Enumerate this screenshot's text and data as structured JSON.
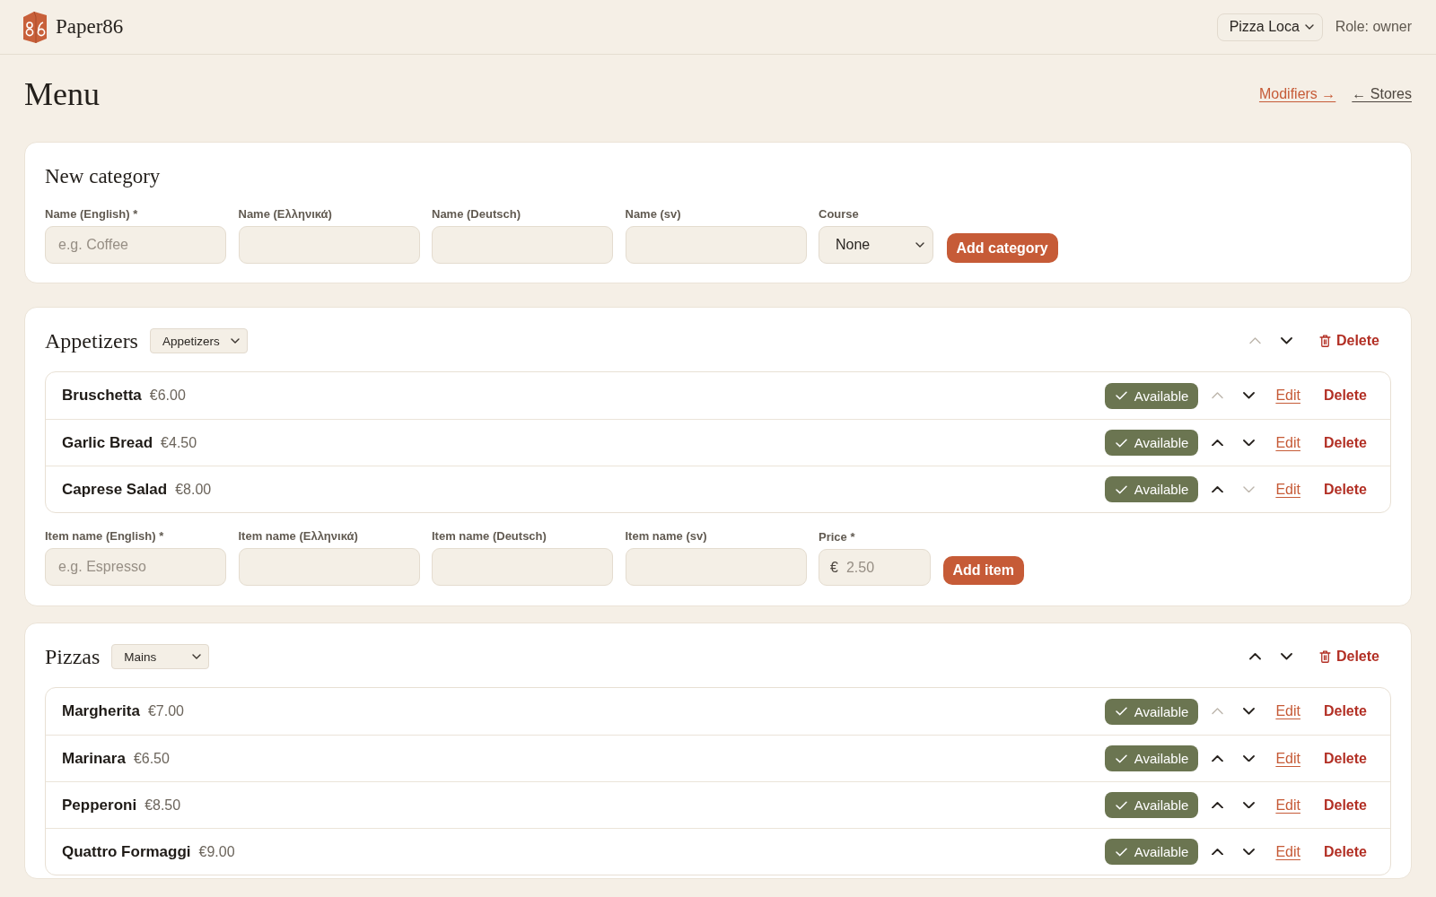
{
  "header": {
    "brand": "Paper86",
    "store": "Pizza Loca",
    "role": "Role: owner"
  },
  "page": {
    "title": "Menu",
    "links": [
      {
        "label": "Modifiers →",
        "kind": "forward"
      },
      {
        "label": "← Stores",
        "kind": "back"
      }
    ]
  },
  "new_category": {
    "title": "New category",
    "fields": [
      {
        "label": "Name (English) *",
        "placeholder": "e.g. Coffee"
      },
      {
        "label": "Name (Ελληνικά)"
      },
      {
        "label": "Name (Deutsch)"
      },
      {
        "label": "Name (sv)"
      }
    ],
    "course": {
      "label": "Course",
      "value": "None"
    },
    "button": "Add category"
  },
  "categories": [
    {
      "name": "Appetizers",
      "course": "Appetizers",
      "up_disabled": true,
      "down_disabled": false,
      "delete": "Delete",
      "items": [
        {
          "name": "Bruschetta",
          "price": "€6.00",
          "available": true,
          "status": "Available",
          "up_disabled": true,
          "down_disabled": false,
          "edit": "Edit",
          "delete": "Delete"
        },
        {
          "name": "Garlic Bread",
          "price": "€4.50",
          "available": true,
          "status": "Available",
          "up_disabled": false,
          "down_disabled": false,
          "edit": "Edit",
          "delete": "Delete"
        },
        {
          "name": "Caprese Salad",
          "price": "€8.00",
          "available": true,
          "status": "Available",
          "up_disabled": false,
          "down_disabled": true,
          "edit": "Edit",
          "delete": "Delete"
        }
      ],
      "item_form": {
        "fields": [
          {
            "label": "Item name (English) *",
            "placeholder": "e.g. Espresso"
          },
          {
            "label": "Item name (Ελληνικά)"
          },
          {
            "label": "Item name (Deutsch)"
          },
          {
            "label": "Item name (sv)"
          }
        ],
        "price": {
          "label": "Price *",
          "currency": "€",
          "placeholder": "2.50"
        },
        "button": "Add item"
      }
    },
    {
      "name": "Pizzas",
      "course": "Mains",
      "up_disabled": false,
      "down_disabled": false,
      "delete": "Delete",
      "items": [
        {
          "name": "Margherita",
          "price": "€7.00",
          "available": true,
          "status": "Available",
          "up_disabled": true,
          "down_disabled": false,
          "edit": "Edit",
          "delete": "Delete"
        },
        {
          "name": "Marinara",
          "price": "€6.50",
          "available": true,
          "status": "Available",
          "up_disabled": false,
          "down_disabled": false,
          "edit": "Edit",
          "delete": "Delete"
        },
        {
          "name": "Pepperoni",
          "price": "€8.50",
          "available": true,
          "status": "Available",
          "up_disabled": false,
          "down_disabled": false,
          "edit": "Edit",
          "delete": "Delete"
        },
        {
          "name": "Quattro Formaggi",
          "price": "€9.00",
          "available": true,
          "status": "Available",
          "up_disabled": false,
          "down_disabled": false,
          "edit": "Edit",
          "delete": "Delete"
        }
      ]
    }
  ]
}
